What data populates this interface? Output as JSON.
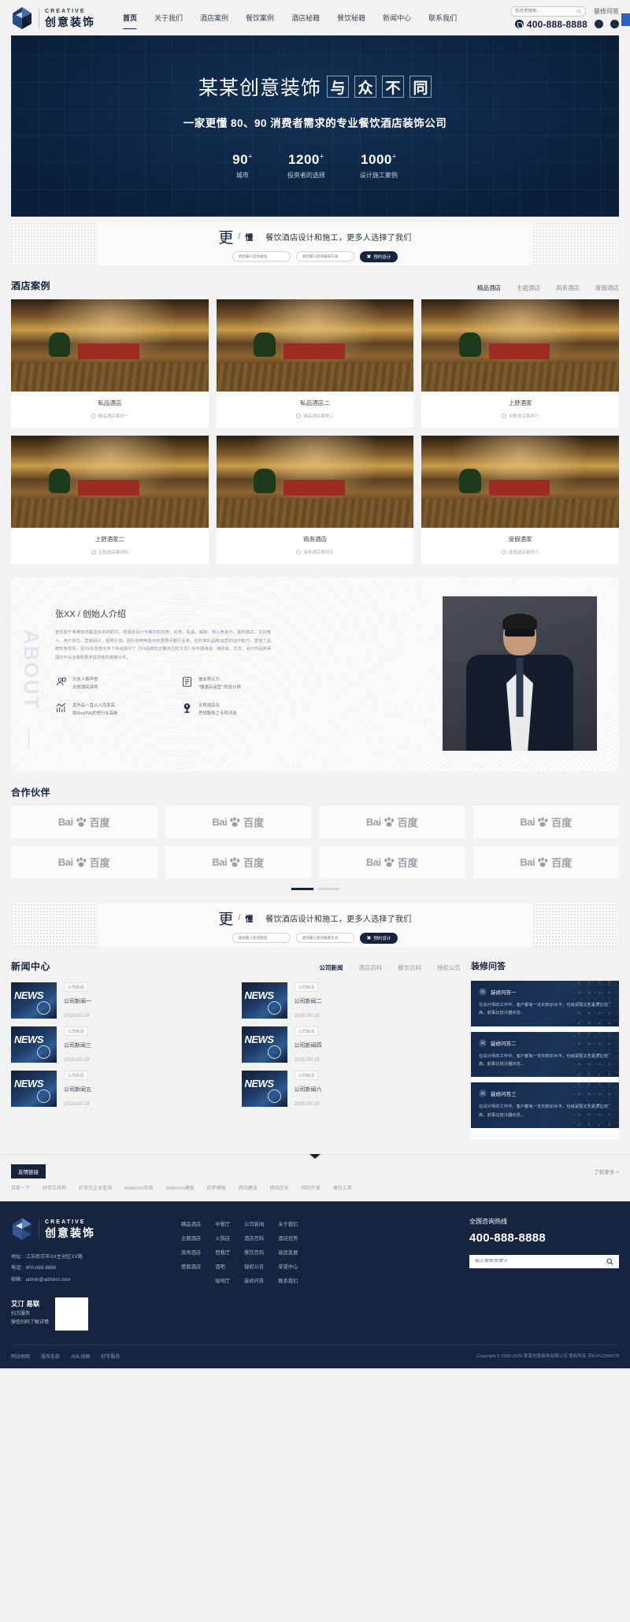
{
  "header": {
    "logo_en": "CREATIVE",
    "logo_cn": "创意装饰",
    "nav": [
      {
        "label": "首页",
        "active": true
      },
      {
        "label": "关于我们",
        "active": false
      },
      {
        "label": "酒店案例",
        "active": false
      },
      {
        "label": "餐饮案例",
        "active": false
      },
      {
        "label": "酒店秘籍",
        "active": false
      },
      {
        "label": "餐饮秘籍",
        "active": false
      },
      {
        "label": "新闻中心",
        "active": false
      },
      {
        "label": "联系我们",
        "active": false
      }
    ],
    "search_placeholder": "在这里搜索...",
    "qa_link": "装修问答",
    "phone": "400-888-8888"
  },
  "hero": {
    "title_cn": "某某创意装饰",
    "title_boxes": [
      "与",
      "众",
      "不",
      "同"
    ],
    "subtitle": "一家更懂 80、90  消费者需求的专业餐饮酒店装饰公司",
    "stats": [
      {
        "num": "90",
        "sup": "+",
        "label": "城市"
      },
      {
        "num": "1200",
        "sup": "+",
        "label": "投资者的选择"
      },
      {
        "num": "1000",
        "sup": "+",
        "label": "设计施工案例"
      }
    ]
  },
  "cta": {
    "big": "更",
    "slash": "/",
    "small": "懂",
    "desc": "餐饮酒店设计和施工，更多人选择了我们",
    "name_placeholder": "请您输入您的姓名",
    "phone_placeholder": "请您输入您的联系方式",
    "button": "预约设计"
  },
  "cases": {
    "title": "酒店案例",
    "tabs": [
      {
        "label": "精品酒店",
        "active": true
      },
      {
        "label": "主题酒店",
        "active": false
      },
      {
        "label": "商务酒店",
        "active": false
      },
      {
        "label": "度假酒店",
        "active": false
      }
    ],
    "items": [
      {
        "name": "私品酒店",
        "meta": "精品酒店案例一"
      },
      {
        "name": "私品酒店二",
        "meta": "精品酒店案例二"
      },
      {
        "name": "上舒酒家",
        "meta": "中野酒店案例三"
      },
      {
        "name": "上舒酒家二",
        "meta": "主题酒店案例四"
      },
      {
        "name": "商务酒店",
        "meta": "商务酒店案例五"
      },
      {
        "name": "度假酒家",
        "meta": "度假酒店案例六"
      }
    ]
  },
  "about": {
    "vertical": "ABOUT",
    "name": "张XX",
    "role": "/ 创始人介绍",
    "paragraph": "曾任职于某某装饰集团多年的研究，把酒店设计与餐饮的优势、劣势、机遇、威胁、核心竞争力、盈利模式、文化植入、用户定位、营销设计、招商引流、团队培养等重点的重要问题行业率，在标准的品牌/运营的运作能力，塑造了品牌形象规划，张XX先生曾在多个场合进行了《XX品牌的正确定位和方法》的专题演讲、演砂会、方法、设计作品获得国内外从业者和更多投资者的高度认可。",
    "features": [
      {
        "icon": "person-badge-icon",
        "line1": "天信人事声誉",
        "line2": "天桥酒店讲师"
      },
      {
        "icon": "book-icon",
        "line1": "被业界认为",
        "line2": "\"懂酒店运营\" 的设计师"
      },
      {
        "icon": "chart-icon",
        "line1": "其作品一直以入住率高",
        "line2": "和Rev(PA)的誉行业高新"
      },
      {
        "icon": "trophy-icon",
        "line1": "天桥酒店业",
        "line2": "思想服务之专项评选"
      }
    ]
  },
  "partners": {
    "title": "合作伙伴",
    "items": [
      {
        "en": "Bai",
        "cn": "百度"
      },
      {
        "en": "Bai",
        "cn": "百度"
      },
      {
        "en": "Bai",
        "cn": "百度"
      },
      {
        "en": "Bai",
        "cn": "百度"
      },
      {
        "en": "Bai",
        "cn": "百度"
      },
      {
        "en": "Bai",
        "cn": "百度"
      },
      {
        "en": "Bai",
        "cn": "百度"
      },
      {
        "en": "Bai",
        "cn": "百度"
      }
    ]
  },
  "cta2": {
    "big": "更",
    "slash": "/",
    "small": "懂",
    "desc": "餐饮酒店设计和施工，更多人选择了我们",
    "name_placeholder": "请您输入您的姓名",
    "phone_placeholder": "请您输入您的联系方式",
    "button": "预约设计"
  },
  "news": {
    "title": "新闻中心",
    "tabs": [
      {
        "label": "公司新闻",
        "active": true
      },
      {
        "label": "酒店百科",
        "active": false
      },
      {
        "label": "餐饮百科",
        "active": false
      },
      {
        "label": "授权公告",
        "active": false
      }
    ],
    "items": [
      {
        "thumb_text": "NEWS",
        "tag": "公司新闻",
        "title": "公司新闻一",
        "date": "2020-02-19"
      },
      {
        "thumb_text": "NEWS",
        "tag": "公司新闻",
        "title": "公司新闻二",
        "date": "2020-02-19"
      },
      {
        "thumb_text": "NEWS",
        "tag": "公司新闻",
        "title": "公司新闻三",
        "date": "2020-02-19"
      },
      {
        "thumb_text": "NEWS",
        "tag": "公司新闻",
        "title": "公司新闻四",
        "date": "2020-02-19"
      },
      {
        "thumb_text": "NEWS",
        "tag": "公司新闻",
        "title": "公司新闻五",
        "date": "2020-02-19"
      },
      {
        "thumb_text": "NEWS",
        "tag": "公司新闻",
        "title": "公司新闻六",
        "date": "2020-02-19"
      }
    ]
  },
  "qa": {
    "title": "装修问答",
    "items": [
      {
        "badge": "问",
        "title": "装修问答一",
        "body": "在设计师的工作中，客户都有一定的知识水平，也就是视文化素质比较高，前事比较冷器状态..."
      },
      {
        "badge": "问",
        "title": "装修问答二",
        "body": "在设计师的工作中，客户都有一定的知识水平，也就是视文化素质比较高，前事比较冷器状态..."
      },
      {
        "badge": "问",
        "title": "装修问答三",
        "body": "在设计师的工作中，客户都有一定的知识水平，也就是视文化素质比较高，前事比较冷器状态..."
      }
    ]
  },
  "links": {
    "chip": "友情链接",
    "more": "了解更多 >",
    "items": [
      "百度一下",
      "好单位名称",
      "好单位企业查询",
      "dedecms官网",
      "dedecms模板",
      "织梦模板",
      "网站建设",
      "网站优化",
      "网站开发",
      "建站工具"
    ]
  },
  "footer": {
    "logo_en": "CREATIVE",
    "logo_cn": "创意装饰",
    "contact": [
      "地址：江苏南京市XX主创区XX路",
      "电话：400-888-8888",
      "邮箱：admin@adminn.com"
    ],
    "qr_big": "艾汀 易联",
    "qr_lines": [
      "扫方服务",
      "微信扫码了解详情"
    ],
    "nav_columns": [
      [
        "精品酒店",
        "主题酒店",
        "商务酒店",
        "度假酒店"
      ],
      [
        "中餐厅",
        "火锅店",
        "西餐厅",
        "酒吧",
        "咖啡厅"
      ],
      [
        "公司新闻",
        "酒店百科",
        "餐饮百科",
        "授权公告",
        "装修问答"
      ],
      [
        "关于我们",
        "酒店优势",
        "高层发展",
        "荣誉中心",
        "联系我们"
      ]
    ],
    "hotline_label": "全国咨询热线",
    "hotline": "400-888-8888",
    "search_placeholder": "输入搜索关键字",
    "bottom_links": [
      "网站地图",
      "服务条款",
      "XML地图",
      "好学服务"
    ],
    "copyright": "Copyright © 2002-2020 某某创意装饰有限公司 版权所有 苏ICP12345678"
  }
}
